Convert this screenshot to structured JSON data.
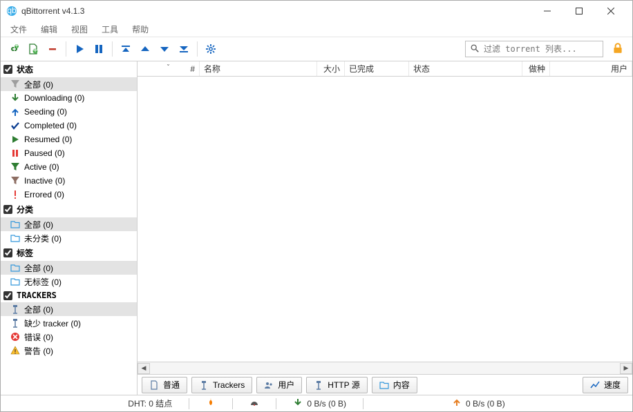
{
  "window": {
    "title": "qBittorrent v4.1.3"
  },
  "menu": {
    "file": "文件",
    "edit": "编辑",
    "view": "视图",
    "tools": "工具",
    "help": "帮助"
  },
  "search": {
    "placeholder": "过滤 torrent 列表..."
  },
  "sidebar": {
    "status": {
      "header": "状态",
      "items": [
        {
          "label": "全部 (0)"
        },
        {
          "label": "Downloading (0)"
        },
        {
          "label": "Seeding (0)"
        },
        {
          "label": "Completed (0)"
        },
        {
          "label": "Resumed (0)"
        },
        {
          "label": "Paused (0)"
        },
        {
          "label": "Active (0)"
        },
        {
          "label": "Inactive (0)"
        },
        {
          "label": "Errored (0)"
        }
      ]
    },
    "category": {
      "header": "分类",
      "items": [
        {
          "label": "全部 (0)"
        },
        {
          "label": "未分类 (0)"
        }
      ]
    },
    "tags": {
      "header": "标签",
      "items": [
        {
          "label": "全部 (0)"
        },
        {
          "label": "无标签 (0)"
        }
      ]
    },
    "trackers": {
      "header": "TRACKERS",
      "items": [
        {
          "label": "全部 (0)"
        },
        {
          "label": "缺少 tracker (0)"
        },
        {
          "label": "错误 (0)"
        },
        {
          "label": "警告 (0)"
        }
      ]
    }
  },
  "columns": {
    "num": "#",
    "name": "名称",
    "size": "大小",
    "done": "已完成",
    "status": "状态",
    "seeds": "做种",
    "peers": "用户"
  },
  "tabs": {
    "general": "普通",
    "trackers": "Trackers",
    "peers": "用户",
    "http": "HTTP 源",
    "content": "内容",
    "speed": "速度"
  },
  "status": {
    "dht": "DHT: 0 结点",
    "down": "0 B/s (0 B)",
    "up": "0 B/s (0 B)"
  }
}
